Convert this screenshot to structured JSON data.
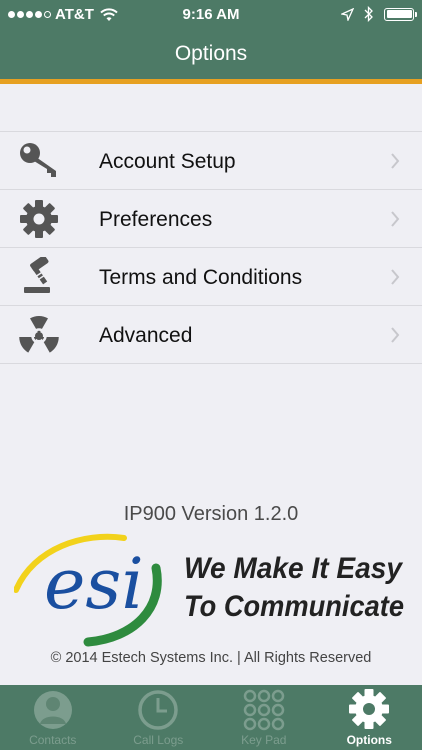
{
  "status_bar": {
    "carrier": "AT&T",
    "time": "9:16 AM",
    "signal_bars_filled": 4,
    "battery_level": 1.0
  },
  "nav": {
    "title": "Options"
  },
  "menu": {
    "items": [
      {
        "label": "Account Setup",
        "icon": "key-icon"
      },
      {
        "label": "Preferences",
        "icon": "gear-icon"
      },
      {
        "label": "Terms and Conditions",
        "icon": "gavel-icon"
      },
      {
        "label": "Advanced",
        "icon": "radiation-icon"
      }
    ]
  },
  "footer": {
    "version": "IP900 Version 1.2.0",
    "logo_text": "esi",
    "tagline_line1": "We Make It Easy",
    "tagline_line2": "To Communicate",
    "copyright": "© 2014 Estech Systems Inc. | All Rights Reserved"
  },
  "tabbar": {
    "tabs": [
      {
        "label": "Contacts",
        "icon": "contact-icon",
        "active": false
      },
      {
        "label": "Call Logs",
        "icon": "clock-icon",
        "active": false
      },
      {
        "label": "Key Pad",
        "icon": "keypad-icon",
        "active": false
      },
      {
        "label": "Options",
        "icon": "gear-icon",
        "active": true
      }
    ]
  },
  "colors": {
    "header": "#4d7a66",
    "accent_line": "#e6a021",
    "background": "#efeff4",
    "logo_blue": "#1a4fa0",
    "logo_green": "#2e8b3e",
    "logo_yellow": "#f2d21b"
  }
}
